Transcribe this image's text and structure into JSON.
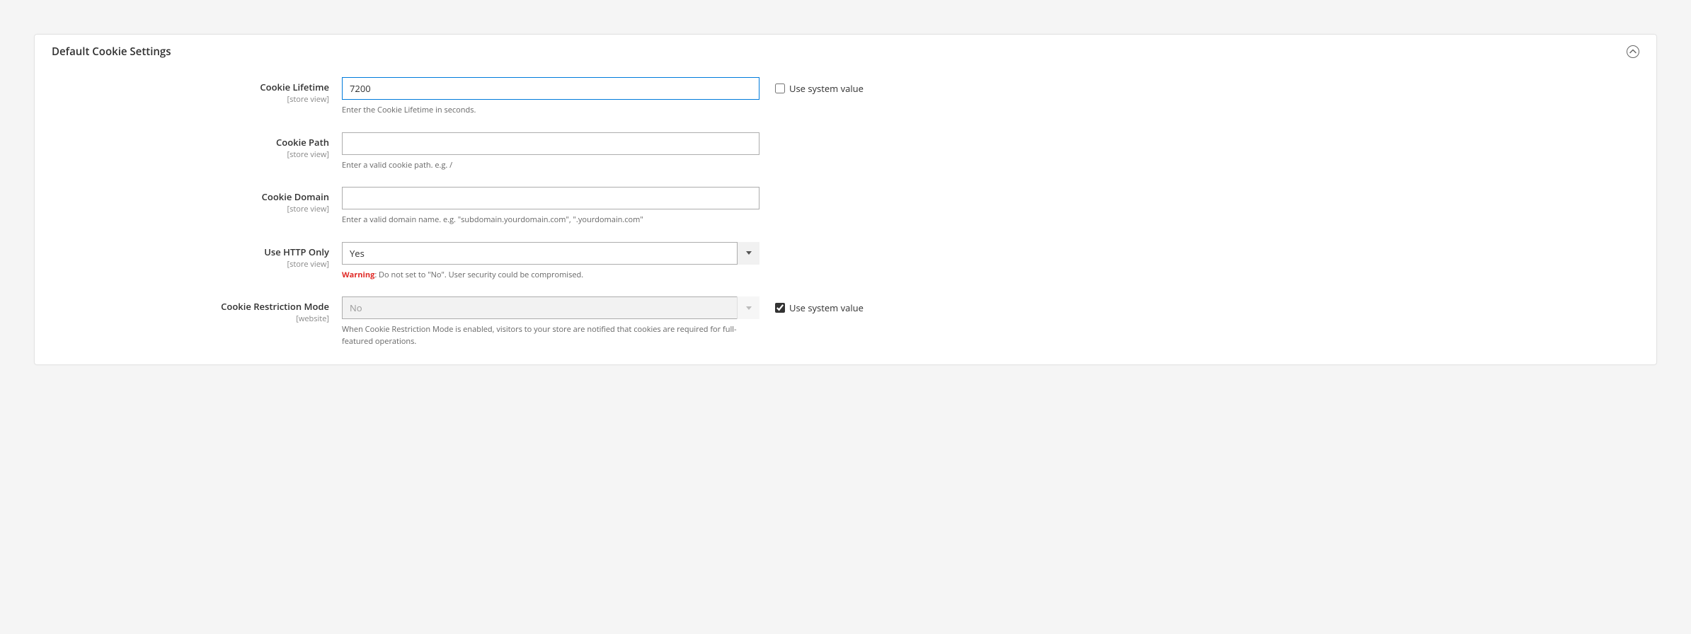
{
  "panel": {
    "title": "Default Cookie Settings"
  },
  "fields": {
    "cookie_lifetime": {
      "label": "Cookie Lifetime",
      "scope": "[store view]",
      "value": "7200",
      "note": "Enter the Cookie Lifetime in seconds.",
      "use_system_label": "Use system value",
      "use_system_checked": false
    },
    "cookie_path": {
      "label": "Cookie Path",
      "scope": "[store view]",
      "value": "",
      "note": "Enter a valid cookie path. e.g. /"
    },
    "cookie_domain": {
      "label": "Cookie Domain",
      "scope": "[store view]",
      "value": "",
      "note": "Enter a valid domain name. e.g. \"subdomain.yourdomain.com\", \".yourdomain.com\""
    },
    "http_only": {
      "label": "Use HTTP Only",
      "scope": "[store view]",
      "value": "Yes",
      "warning_label": "Warning",
      "note_rest": ": Do not set to \"No\". User security could be compromised."
    },
    "restriction_mode": {
      "label": "Cookie Restriction Mode",
      "scope": "[website]",
      "value": "No",
      "note": "When Cookie Restriction Mode is enabled, visitors to your store are notified that cookies are required for full-featured operations.",
      "use_system_label": "Use system value",
      "use_system_checked": true
    }
  }
}
